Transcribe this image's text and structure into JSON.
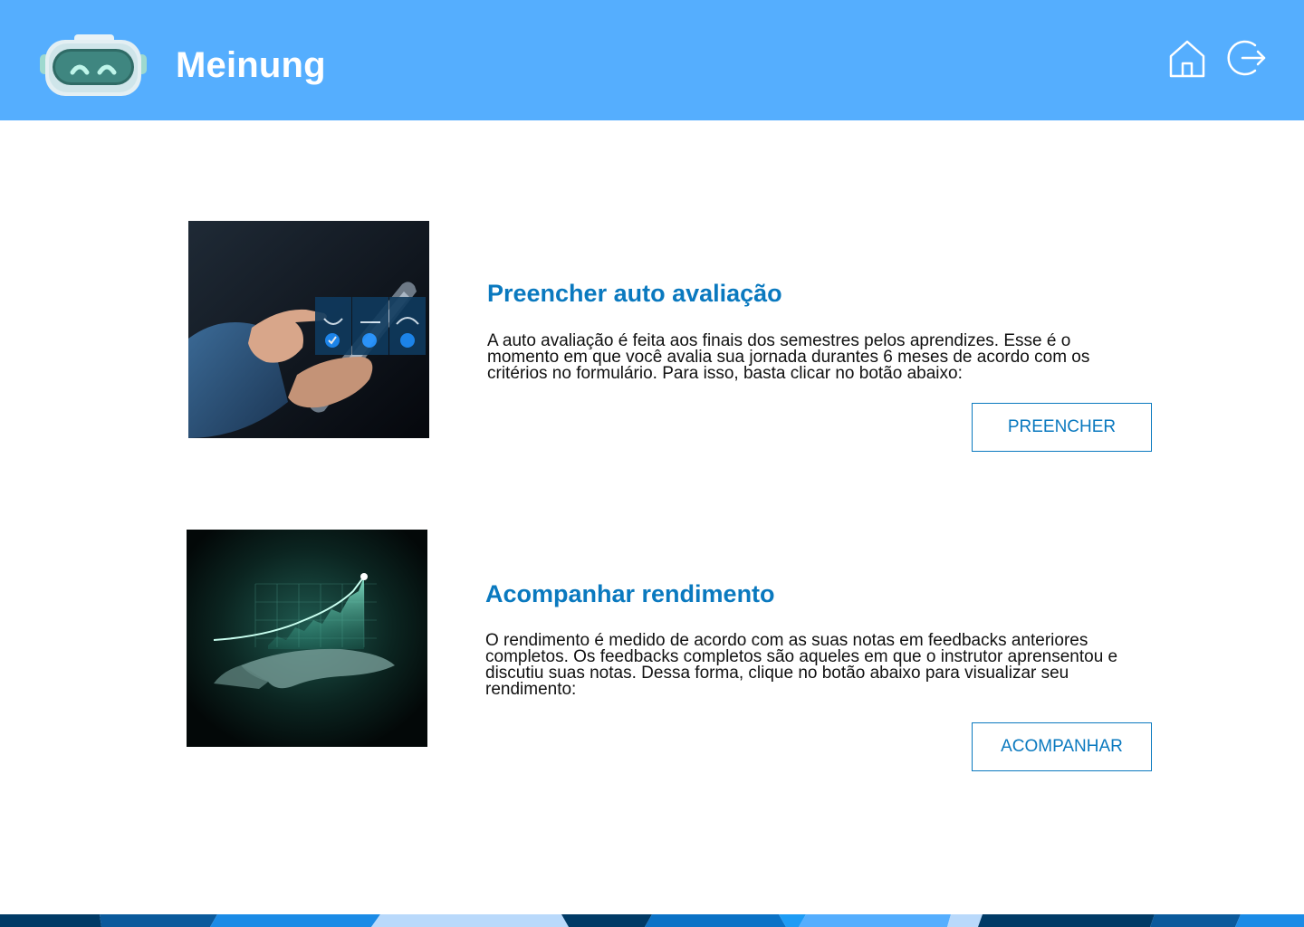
{
  "header": {
    "brand": "Meinung",
    "logo_icon": "robot-mascot-icon",
    "home_icon": "home-icon",
    "logout_icon": "logout-icon",
    "background_color": "#55aefe"
  },
  "cards": [
    {
      "title": "Preencher auto avaliação",
      "text": "A auto avaliação é feita aos finais dos semestres pelos aprendizes. Esse é o momento em que você avalia sua jornada durantes 6 meses de acordo com os critérios no formulário. Para isso, basta clicar no botão abaixo:",
      "button_label": "PREENCHER",
      "image_icon": "tablet-feedback-photo"
    },
    {
      "title": "Acompanhar rendimento",
      "text": "O rendimento é medido de acordo com as suas notas em feedbacks anteriores completos. Os feedbacks completos são aqueles em que o instrutor aprensentou e discutiu suas notas. Dessa forma, clique no botão abaixo para visualizar seu rendimento:",
      "button_label": "ACOMPANHAR",
      "image_icon": "growth-chart-photo"
    }
  ],
  "colors": {
    "accent": "#0a79bf",
    "header": "#55aefe"
  }
}
